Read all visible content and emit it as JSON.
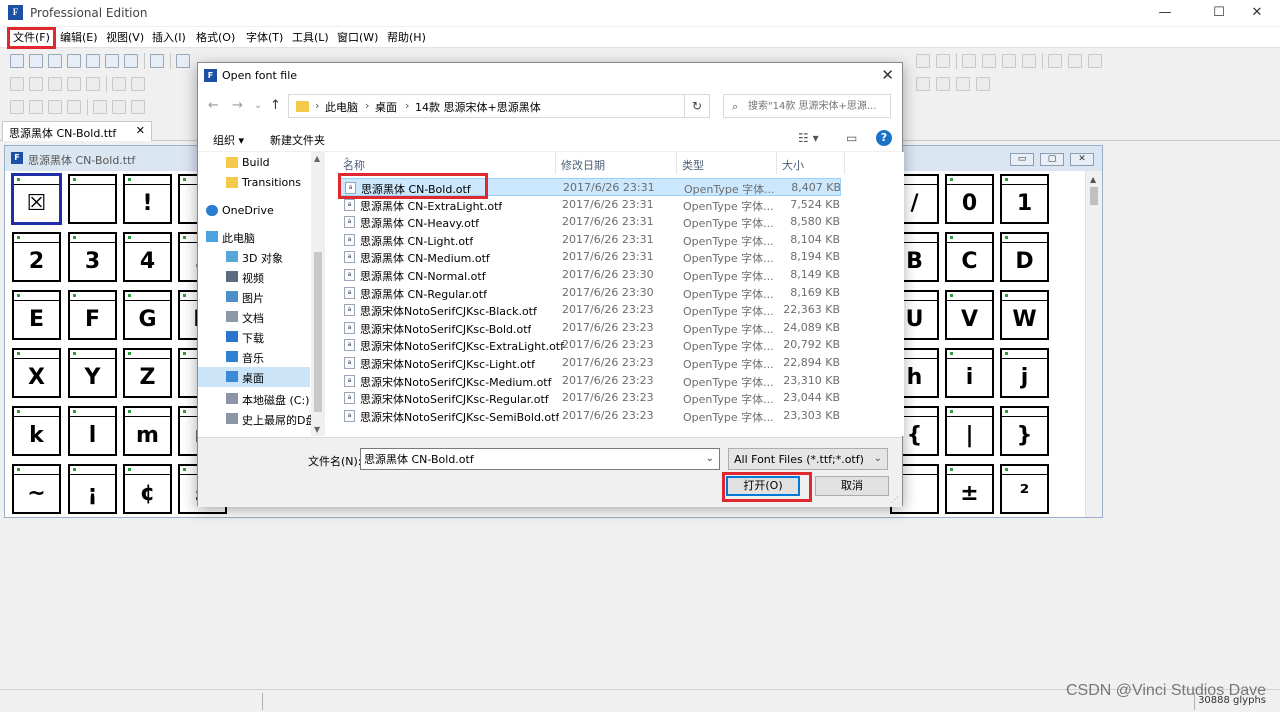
{
  "app": {
    "title": "Professional Edition",
    "icon_text": "F"
  },
  "window_controls": {
    "minimize": "—",
    "maximize": "☐",
    "close": "✕"
  },
  "menu": [
    {
      "label": "文件(F)"
    },
    {
      "label": "编辑(E)"
    },
    {
      "label": "视图(V)"
    },
    {
      "label": "插入(I)"
    },
    {
      "label": "格式(O)"
    },
    {
      "label": "字体(T)"
    },
    {
      "label": "工具(L)"
    },
    {
      "label": "窗口(W)"
    },
    {
      "label": "帮助(H)"
    }
  ],
  "doc_tab": {
    "label": "思源黑体 CN-Bold.ttf",
    "close": "✕"
  },
  "font_window": {
    "title": "思源黑体 CN-Bold.ttf",
    "controls": [
      "▭",
      "▢",
      "✕"
    ],
    "glyph_rows": [
      [
        "☒",
        "",
        "!",
        "\""
      ],
      [
        "2",
        "3",
        "4",
        "5"
      ],
      [
        "E",
        "F",
        "G",
        "H"
      ],
      [
        "X",
        "Y",
        "Z",
        "["
      ],
      [
        "k",
        "l",
        "m",
        "n"
      ],
      [
        "~",
        "¡",
        "¢",
        "£"
      ]
    ],
    "glyph_rows_right": [
      [
        "/",
        "0",
        "1"
      ],
      [
        "B",
        "C",
        "D"
      ],
      [
        "U",
        "V",
        "W"
      ],
      [
        "h",
        "i",
        "j"
      ],
      [
        "{",
        "|",
        "}"
      ],
      [
        "",
        "±",
        "²"
      ]
    ]
  },
  "dialog": {
    "title": "Open font file",
    "close": "✕",
    "nav": {
      "back": "←",
      "forward": "→",
      "recent": "⌄",
      "up": "↑",
      "refresh": "↻"
    },
    "breadcrumb": [
      "此电脑",
      "桌面",
      "14款 思源宋体+思源黑体"
    ],
    "breadcrumb_sep": "›",
    "search_placeholder": "搜索\"14款 思源宋体+思源...",
    "commands": {
      "organize": "组织 ▾",
      "new_folder": "新建文件夹",
      "view": "☷ ▾",
      "preview": "▭",
      "help": "?"
    },
    "nav_items": [
      {
        "label": "Build",
        "icon": "folder-icon"
      },
      {
        "label": "Transitions",
        "icon": "folder-icon"
      },
      {
        "label": "OneDrive",
        "icon": "cloud-icon"
      },
      {
        "label": "此电脑",
        "icon": "computer-icon"
      },
      {
        "label": "3D 对象",
        "icon": "cube-icon"
      },
      {
        "label": "视频",
        "icon": "video-icon"
      },
      {
        "label": "图片",
        "icon": "picture-icon"
      },
      {
        "label": "文档",
        "icon": "document-icon"
      },
      {
        "label": "下载",
        "icon": "download-icon"
      },
      {
        "label": "音乐",
        "icon": "music-icon"
      },
      {
        "label": "桌面",
        "icon": "desktop-icon"
      },
      {
        "label": "本地磁盘 (C:)",
        "icon": "drive-icon"
      },
      {
        "label": "史上最屌的D盘",
        "icon": "drive-icon"
      }
    ],
    "columns": {
      "name": "名称",
      "date": "修改日期",
      "type": "类型",
      "size": "大小"
    },
    "files": [
      {
        "name": "思源黑体 CN-Bold.otf",
        "date": "2017/6/26 23:31",
        "type": "OpenType 字体...",
        "size": "8,407 KB"
      },
      {
        "name": "思源黑体 CN-ExtraLight.otf",
        "date": "2017/6/26 23:31",
        "type": "OpenType 字体...",
        "size": "7,524 KB"
      },
      {
        "name": "思源黑体 CN-Heavy.otf",
        "date": "2017/6/26 23:31",
        "type": "OpenType 字体...",
        "size": "8,580 KB"
      },
      {
        "name": "思源黑体 CN-Light.otf",
        "date": "2017/6/26 23:31",
        "type": "OpenType 字体...",
        "size": "8,104 KB"
      },
      {
        "name": "思源黑体 CN-Medium.otf",
        "date": "2017/6/26 23:31",
        "type": "OpenType 字体...",
        "size": "8,194 KB"
      },
      {
        "name": "思源黑体 CN-Normal.otf",
        "date": "2017/6/26 23:30",
        "type": "OpenType 字体...",
        "size": "8,149 KB"
      },
      {
        "name": "思源黑体 CN-Regular.otf",
        "date": "2017/6/26 23:30",
        "type": "OpenType 字体...",
        "size": "8,169 KB"
      },
      {
        "name": "思源宋体NotoSerifCJKsc-Black.otf",
        "date": "2017/6/26 23:23",
        "type": "OpenType 字体...",
        "size": "22,363 KB"
      },
      {
        "name": "思源宋体NotoSerifCJKsc-Bold.otf",
        "date": "2017/6/26 23:23",
        "type": "OpenType 字体...",
        "size": "24,089 KB"
      },
      {
        "name": "思源宋体NotoSerifCJKsc-ExtraLight.otf",
        "date": "2017/6/26 23:23",
        "type": "OpenType 字体...",
        "size": "20,792 KB"
      },
      {
        "name": "思源宋体NotoSerifCJKsc-Light.otf",
        "date": "2017/6/26 23:23",
        "type": "OpenType 字体...",
        "size": "22,894 KB"
      },
      {
        "name": "思源宋体NotoSerifCJKsc-Medium.otf",
        "date": "2017/6/26 23:23",
        "type": "OpenType 字体...",
        "size": "23,310 KB"
      },
      {
        "name": "思源宋体NotoSerifCJKsc-Regular.otf",
        "date": "2017/6/26 23:23",
        "type": "OpenType 字体...",
        "size": "23,044 KB"
      },
      {
        "name": "思源宋体NotoSerifCJKsc-SemiBold.otf",
        "date": "2017/6/26 23:23",
        "type": "OpenType 字体...",
        "size": "23,303 KB"
      }
    ],
    "filename_label": "文件名(N):",
    "filename_value": "思源黑体 CN-Bold.otf",
    "filetype_value": "All Font Files (*.ttf;*.otf)",
    "open_button": "打开(O)",
    "cancel_button": "取消"
  },
  "status": {
    "glyph_count": "30888 glyphs",
    "watermark": "CSDN @Vinci Studios Dave"
  },
  "colors": {
    "highlight": "#e0282e",
    "selection": "#cce8ff",
    "accent": "#0078d7"
  }
}
